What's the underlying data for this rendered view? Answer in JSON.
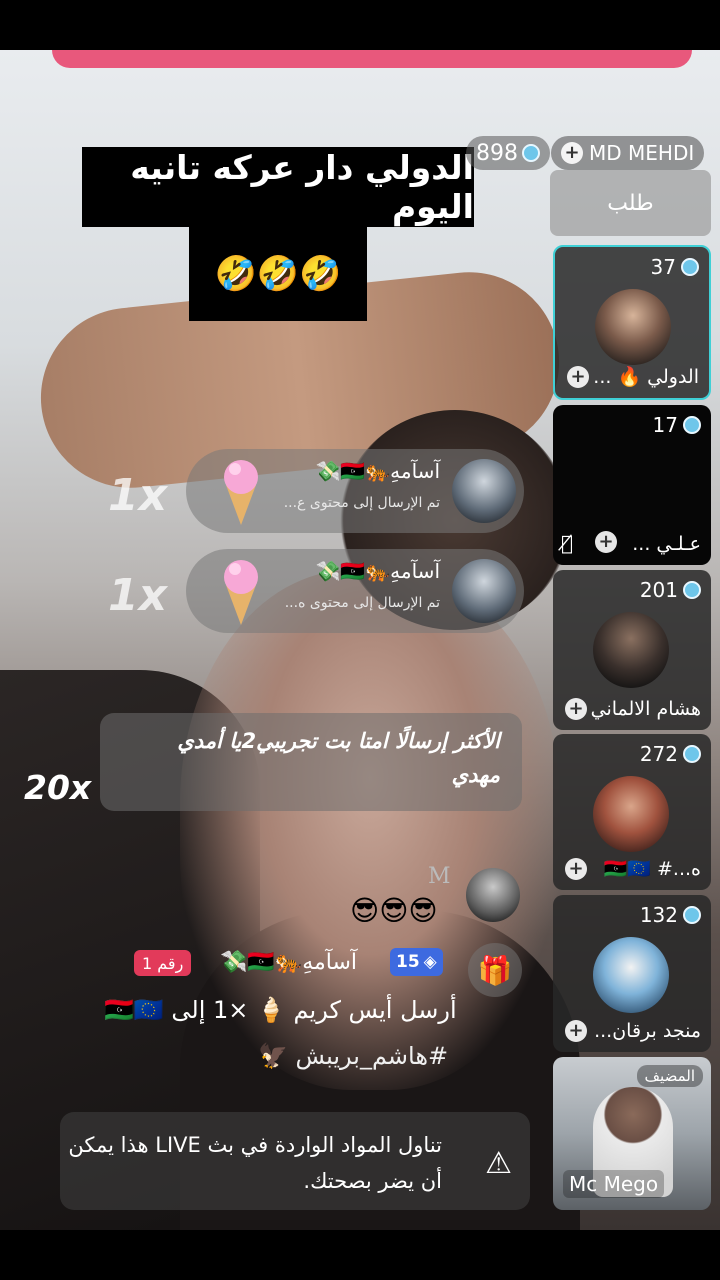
{
  "caption": {
    "line1": "الدولي دار عركه تانيه اليوم",
    "line2": "🤣🤣🤣"
  },
  "viewer_count": "898",
  "host": {
    "name": "MD MEHDI",
    "tile_label": "المضيف",
    "tile_name": "Mc Mego"
  },
  "request_label": "طلب",
  "guests": [
    {
      "score": "37",
      "name": "الدولي 🔥 ..."
    },
    {
      "score": "17",
      "name": "عـلـي ..."
    },
    {
      "score": "201",
      "name": "هشام الالماني"
    },
    {
      "score": "272",
      "name": "ه...# 🇱🇾🇪🇺"
    },
    {
      "score": "132",
      "name": "منجد برقان..."
    }
  ],
  "gifts": [
    {
      "user": "آسآمهِ🐅🇱🇾💸",
      "desc": "تم الإرسال إلى محتوى ع...",
      "multiplier": "1x"
    },
    {
      "user": "آسآمهِ🐅🇱🇾💸",
      "desc": "تم الإرسال إلى محتوى ه...",
      "multiplier": "1x"
    }
  ],
  "top_banner": {
    "text": "الأكثر إرسالًا امتا بت تجريبي2يا أمدي مهدي",
    "multiplier": "20x"
  },
  "chat": {
    "initial": "M",
    "emoji": "😎😎😎",
    "level": "15",
    "username": "آسآمهِ🐅🇱🇾💸",
    "rank_label": "رقم 1",
    "message": "أرسل أيس كريم 🍦 ×1 إلى 🇱🇾🇪🇺",
    "hashtag": "#هاشم_بريبش 🦅"
  },
  "warning_text": "تناول المواد الواردة في بث LIVE هذا يمكن أن يضر بصحتك.",
  "icons": {
    "gem": "diamond-icon",
    "plus": "plus-icon",
    "gift": "gift-icon",
    "warning": "warning-icon",
    "mic": "mic-off-icon"
  }
}
